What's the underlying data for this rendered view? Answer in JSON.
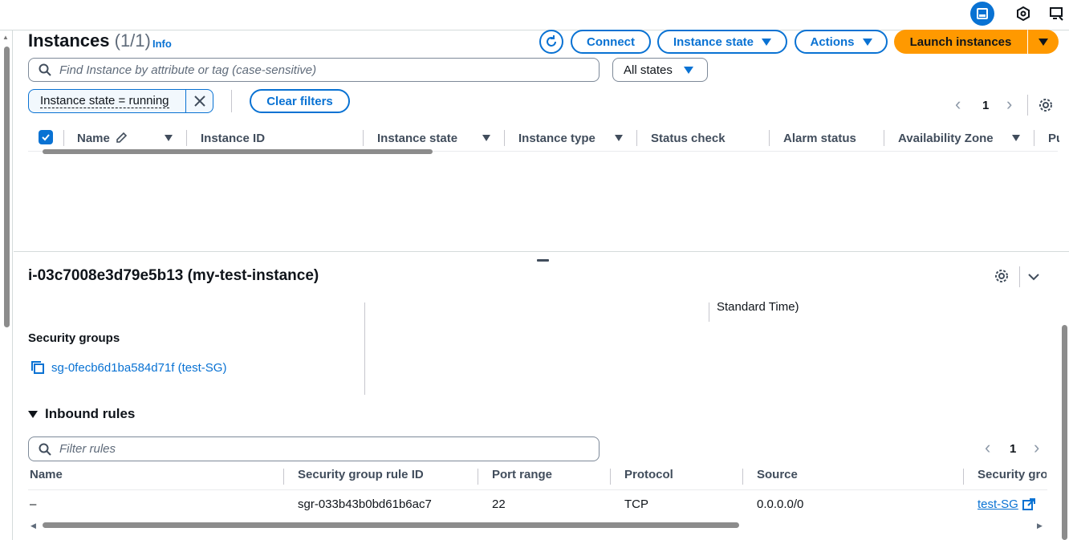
{
  "header": {
    "title": "Instances",
    "count": "(1/1)",
    "info": "Info",
    "connect": "Connect",
    "instance_state": "Instance state",
    "actions": "Actions",
    "launch": "Launch instances"
  },
  "search": {
    "placeholder": "Find Instance by attribute or tag (case-sensitive)"
  },
  "state_select": {
    "value": "All states"
  },
  "filter_token": {
    "label": "Instance state = running"
  },
  "clear_filters": "Clear filters",
  "pagination": {
    "page": "1"
  },
  "table": {
    "columns": [
      "Name",
      "Instance ID",
      "Instance state",
      "Instance type",
      "Status check",
      "Alarm status",
      "Availability Zone",
      "Pu"
    ]
  },
  "details": {
    "title": "i-03c7008e3d79e5b13 (my-test-instance)",
    "partial_text": "Standard Time)",
    "security_groups_label": "Security groups",
    "security_group": "sg-0fecb6d1ba584d71f (test-SG)",
    "inbound_heading": "Inbound rules",
    "filter_placeholder": "Filter rules",
    "pagination_page": "1",
    "rules_columns": [
      "Name",
      "Security group rule ID",
      "Port range",
      "Protocol",
      "Source",
      "Security gro"
    ],
    "rules": [
      {
        "name": "–",
        "rule_id": "sgr-033b43b0bd61b6ac7",
        "port": "22",
        "protocol": "TCP",
        "source": "0.0.0.0/0",
        "sg": "test-SG"
      }
    ]
  },
  "colors": {
    "accent": "#0972d3",
    "launch": "#ff9900"
  }
}
